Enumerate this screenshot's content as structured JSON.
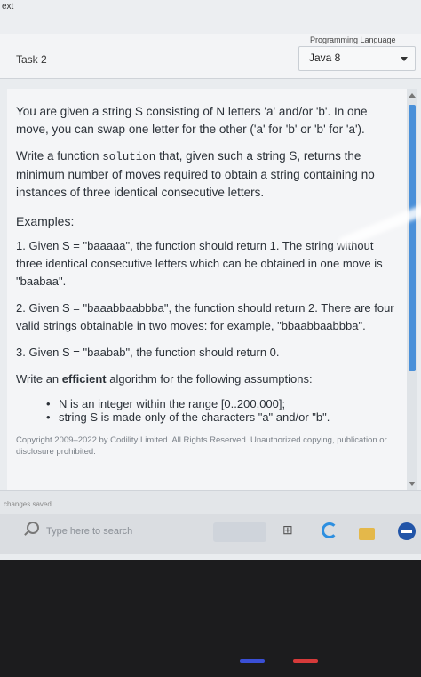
{
  "browser": {
    "tab_text": "ext"
  },
  "header": {
    "task_title": "Task 2",
    "language_label": "Programming Language",
    "language_value": "Java 8"
  },
  "problem": {
    "intro": "You are given a string S consisting of N letters 'a' and/or 'b'. In one move, you can swap one letter for the other ('a' for 'b' or 'b' for 'a').",
    "task_pre": "Write a function ",
    "task_code": "solution",
    "task_post": " that, given such a string S, returns the minimum number of moves required to obtain a string containing no instances of three identical consecutive letters.",
    "examples_title": "Examples:",
    "examples": [
      "1. Given S = \"baaaaa\", the function should return 1. The string without three identical consecutive letters which can be obtained in one move is \"baabaa\".",
      "2. Given S = \"baaabbaabbba\", the function should return 2. There are four valid strings obtainable in two moves: for example, \"bbaabbaabbba\".",
      "3. Given S = \"baabab\", the function should return 0."
    ],
    "efficient_pre": "Write an ",
    "efficient_bold": "efficient",
    "efficient_post": " algorithm for the following assumptions:",
    "assumptions": [
      "N is an integer within the range [0..200,000];",
      "string S is made only of the characters \"a\" and/or \"b\"."
    ],
    "copyright": "Copyright 2009–2022 by Codility Limited. All Rights Reserved. Unauthorized copying, publication or disclosure prohibited."
  },
  "status": {
    "saved_text": "changes saved"
  },
  "taskbar": {
    "search_placeholder": "Type here to search"
  },
  "colors": {
    "accent": "#4a90d9",
    "panel_bg": "#f4f5f7",
    "bezel": "#1c1c1e"
  }
}
